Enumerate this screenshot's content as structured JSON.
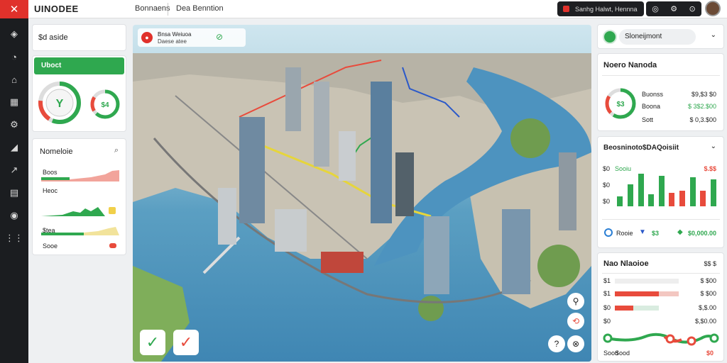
{
  "app": {
    "brand": "UINODEE"
  },
  "topbar": {
    "tabs": [
      "Bonnaens",
      "Dea Benntion"
    ],
    "search_text": "Sanhg Halwt, Hennna",
    "icons": [
      "info-icon",
      "settings-icon",
      "bell-icon"
    ]
  },
  "sidebar": {
    "icons": [
      "compass-icon",
      "gauge-icon",
      "buildings-icon",
      "city-icon",
      "tools-icon",
      "chart-icon",
      "trend-icon",
      "report-icon",
      "globe-icon",
      "grid-icon"
    ]
  },
  "left_panel": {
    "header": "$d aside",
    "green_tab": "Uboct",
    "gauge_big_label": "Y",
    "gauge_small_label": "$4",
    "metrics_title": "Nomeloie",
    "metrics": [
      {
        "label": "Boos"
      },
      {
        "label": "Heoc"
      },
      {
        "label": "$tea"
      },
      {
        "label": "Sooe"
      }
    ]
  },
  "map": {
    "overlay_title": "Bnsa Weiuoa",
    "overlay_sub": "Daese atee"
  },
  "right_panel": {
    "profile_label": "Sloneijmont",
    "card1_title": "Noero Nanoda",
    "card1_rows": [
      {
        "label": "Buonss",
        "value": "$9,$3 $0"
      },
      {
        "label": "Boona",
        "value": "$ 3$2.$00"
      },
      {
        "label": "Sott",
        "value": "$ 0,3.$00"
      }
    ],
    "card1_gauge": "$3",
    "card2_title": "Beosninoto$DAQoisiit",
    "card2_yticks": [
      "$0",
      "$0",
      "$0"
    ],
    "card2_top_left": "Sooiu",
    "card2_top_right": "$.$$",
    "card2_bars": [
      {
        "color": "#2fa84f",
        "value": 0.3
      },
      {
        "color": "#2fa84f",
        "value": 0.65
      },
      {
        "color": "#2fa84f",
        "value": 0.95
      },
      {
        "color": "#2fa84f",
        "value": 0.35
      },
      {
        "color": "#2fa84f",
        "value": 0.9
      },
      {
        "color": "#e84b3c",
        "value": 0.4
      },
      {
        "color": "#e84b3c",
        "value": 0.45
      },
      {
        "color": "#2fa84f",
        "value": 0.85
      },
      {
        "color": "#e84b3c",
        "value": 0.45
      },
      {
        "color": "#2fa84f",
        "value": 0.8
      }
    ],
    "card2_footer": [
      "Rooie",
      "$3",
      "$0,000.00"
    ],
    "card3_title": "Nao Nlaoioe",
    "card3_head_value": "$$ $",
    "card3_rows": [
      {
        "label": "$1",
        "value": "$ $00"
      },
      {
        "label": "$1",
        "value": "$ $00"
      },
      {
        "label": "$0",
        "value": "$,$.00"
      },
      {
        "label": "$0",
        "value": "$,$0.00"
      }
    ],
    "card3_footer": [
      "Sood",
      "$0"
    ]
  },
  "colors": {
    "accent": "#e0312b",
    "green": "#2fa84f",
    "dark": "#1e1f22"
  }
}
